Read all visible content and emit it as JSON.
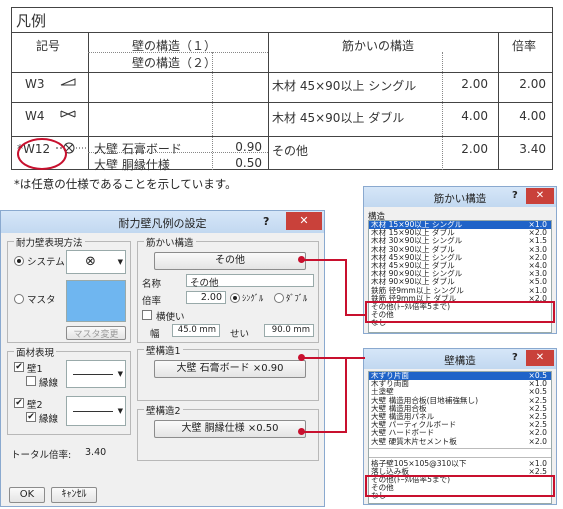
{
  "legend": {
    "title": "凡例",
    "headers": {
      "symbol": "記号",
      "wall": "壁の構造（１）",
      "wall2": "壁の構造（２）",
      "brace": "筋かいの構造",
      "ratio": "倍率"
    },
    "rows": [
      {
        "symbol": "W3",
        "brace": "木材 45×90以上 シングル",
        "brace_val": "2.00",
        "ratio": "2.00"
      },
      {
        "symbol": "W4",
        "brace": "木材 45×90以上 ダブル",
        "brace_val": "4.00",
        "ratio": "4.00"
      },
      {
        "symbol": "*W12",
        "wall1": "大壁 石膏ボード",
        "wall1_val": "0.90",
        "wall2": "大壁 胴縁仕様",
        "wall2_val": "0.50",
        "brace": "その他",
        "brace_val": "2.00",
        "ratio": "3.40"
      }
    ],
    "note": "*は任意の仕様であることを示しています。"
  },
  "dialog": {
    "title": "耐力壁凡例の設定",
    "help": "?",
    "close": "✕",
    "method_group": "耐力壁表現方法",
    "radio_system": "システム",
    "radio_master": "マスタ",
    "master_change": "マスタ変更",
    "material_group": "面材表現",
    "wall1": "壁1",
    "wall2": "壁2",
    "border_line": "縁線",
    "total_label": "トータル倍率:",
    "total_value": "3.40",
    "ok": "OK",
    "cancel": "ｷｬﾝｾﾙ",
    "brace_group": "筋かい構造",
    "brace_button": "その他",
    "name_label": "名称",
    "name_value": "その他",
    "ratio_label": "倍率",
    "ratio_value": "2.00",
    "single": "ｼﾝｸﾞﾙ",
    "double": "ﾀﾞﾌﾞﾙ",
    "horizontal": "横使い",
    "width_label": "幅",
    "width_value": "45.0 mm",
    "thickness_label": "せい",
    "thickness_value": "90.0 mm",
    "wall_structure1_group": "壁構造1",
    "wall_structure1_button": "大壁 石膏ボード ×0.90",
    "wall_structure2_group": "壁構造2",
    "wall_structure2_button": "大壁 胴縁仕様 ×0.50"
  },
  "brace_window": {
    "title": "筋かい構造",
    "help": "?",
    "close": "✕",
    "label": "構造",
    "items": [
      {
        "name": "木材 15×90以上 シングル",
        "value": "×1.0"
      },
      {
        "name": "木材 15×90以上 ダブル",
        "value": "×2.0"
      },
      {
        "name": "木材 30×90以上 シングル",
        "value": "×1.5"
      },
      {
        "name": "木材 30×90以上 ダブル",
        "value": "×3.0"
      },
      {
        "name": "木材 45×90以上 シングル",
        "value": "×2.0"
      },
      {
        "name": "木材 45×90以上 ダブル",
        "value": "×4.0"
      },
      {
        "name": "木材 90×90以上 シングル",
        "value": "×3.0"
      },
      {
        "name": "木材 90×90以上 ダブル",
        "value": "×5.0"
      },
      {
        "name": "鉄筋 径9mm以上 シングル",
        "value": "×1.0"
      },
      {
        "name": "鉄筋 径9mm以上 ダブル",
        "value": "×2.0"
      },
      {
        "name": "その他(ﾄｰﾀﾙ倍率5まで)",
        "value": ""
      },
      {
        "name": "その他",
        "value": ""
      },
      {
        "name": "なし",
        "value": ""
      }
    ]
  },
  "wall_window": {
    "title": "壁構造",
    "help": "?",
    "close": "✕",
    "items": [
      {
        "name": "木ずり片面",
        "value": "×0.5"
      },
      {
        "name": "木ずり両面",
        "value": "×1.0"
      },
      {
        "name": "土塗壁",
        "value": "×0.5"
      },
      {
        "name": "大壁 構造用合板(目地補強無し)",
        "value": "×2.5"
      },
      {
        "name": "大壁 構造用合板",
        "value": "×2.5"
      },
      {
        "name": "大壁 構造用パネル",
        "value": "×2.5"
      },
      {
        "name": "大壁 パーティクルボード",
        "value": "×2.5"
      },
      {
        "name": "大壁 ハードボード",
        "value": "×2.0"
      },
      {
        "name": "大壁 硬質木片セメント板",
        "value": "×2.0"
      },
      {
        "name": "格子壁105×105@310以下",
        "value": "×1.0"
      },
      {
        "name": "落し込み板",
        "value": "×2.5"
      },
      {
        "name": "その他(ﾄｰﾀﾙ倍率5まで)",
        "value": ""
      },
      {
        "name": "その他",
        "value": ""
      },
      {
        "name": "なし",
        "value": ""
      }
    ]
  }
}
